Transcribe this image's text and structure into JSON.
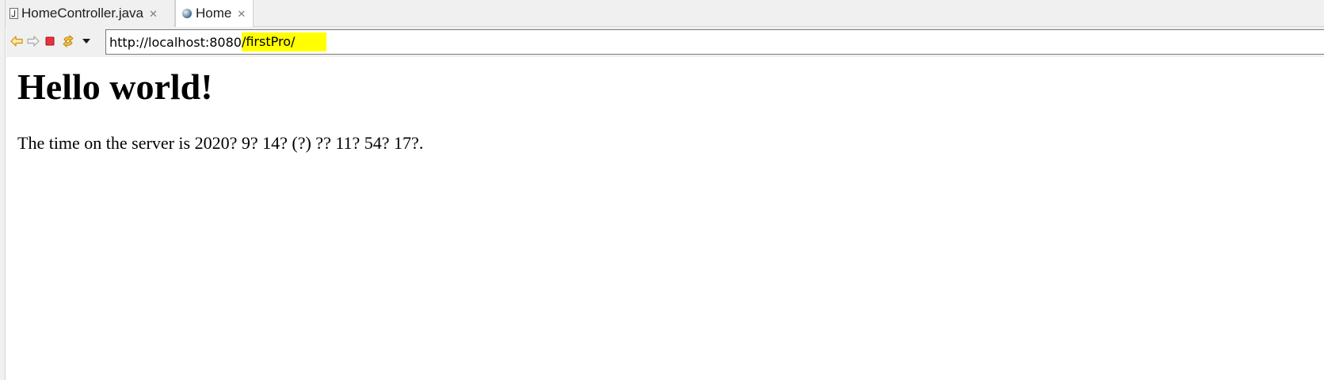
{
  "tabs": [
    {
      "label": "HomeController.java",
      "icon": "java-file-icon",
      "close_icon": "close-icon"
    },
    {
      "label": "Home",
      "icon": "globe-icon",
      "close_icon": "close-icon"
    }
  ],
  "toolbar": {
    "back_icon": "back-arrow-icon",
    "forward_icon": "forward-arrow-icon",
    "stop_icon": "stop-icon",
    "refresh_icon": "refresh-icon",
    "menu_icon": "dropdown-arrow-icon",
    "url_prefix": "http://localhost:8080",
    "url_highlighted": "/firstPro/",
    "highlight_color": "#ffff00"
  },
  "page": {
    "heading": "Hello world!",
    "message": "The time on the server is 2020? 9? 14? (?) ?? 11? 54? 17?."
  }
}
